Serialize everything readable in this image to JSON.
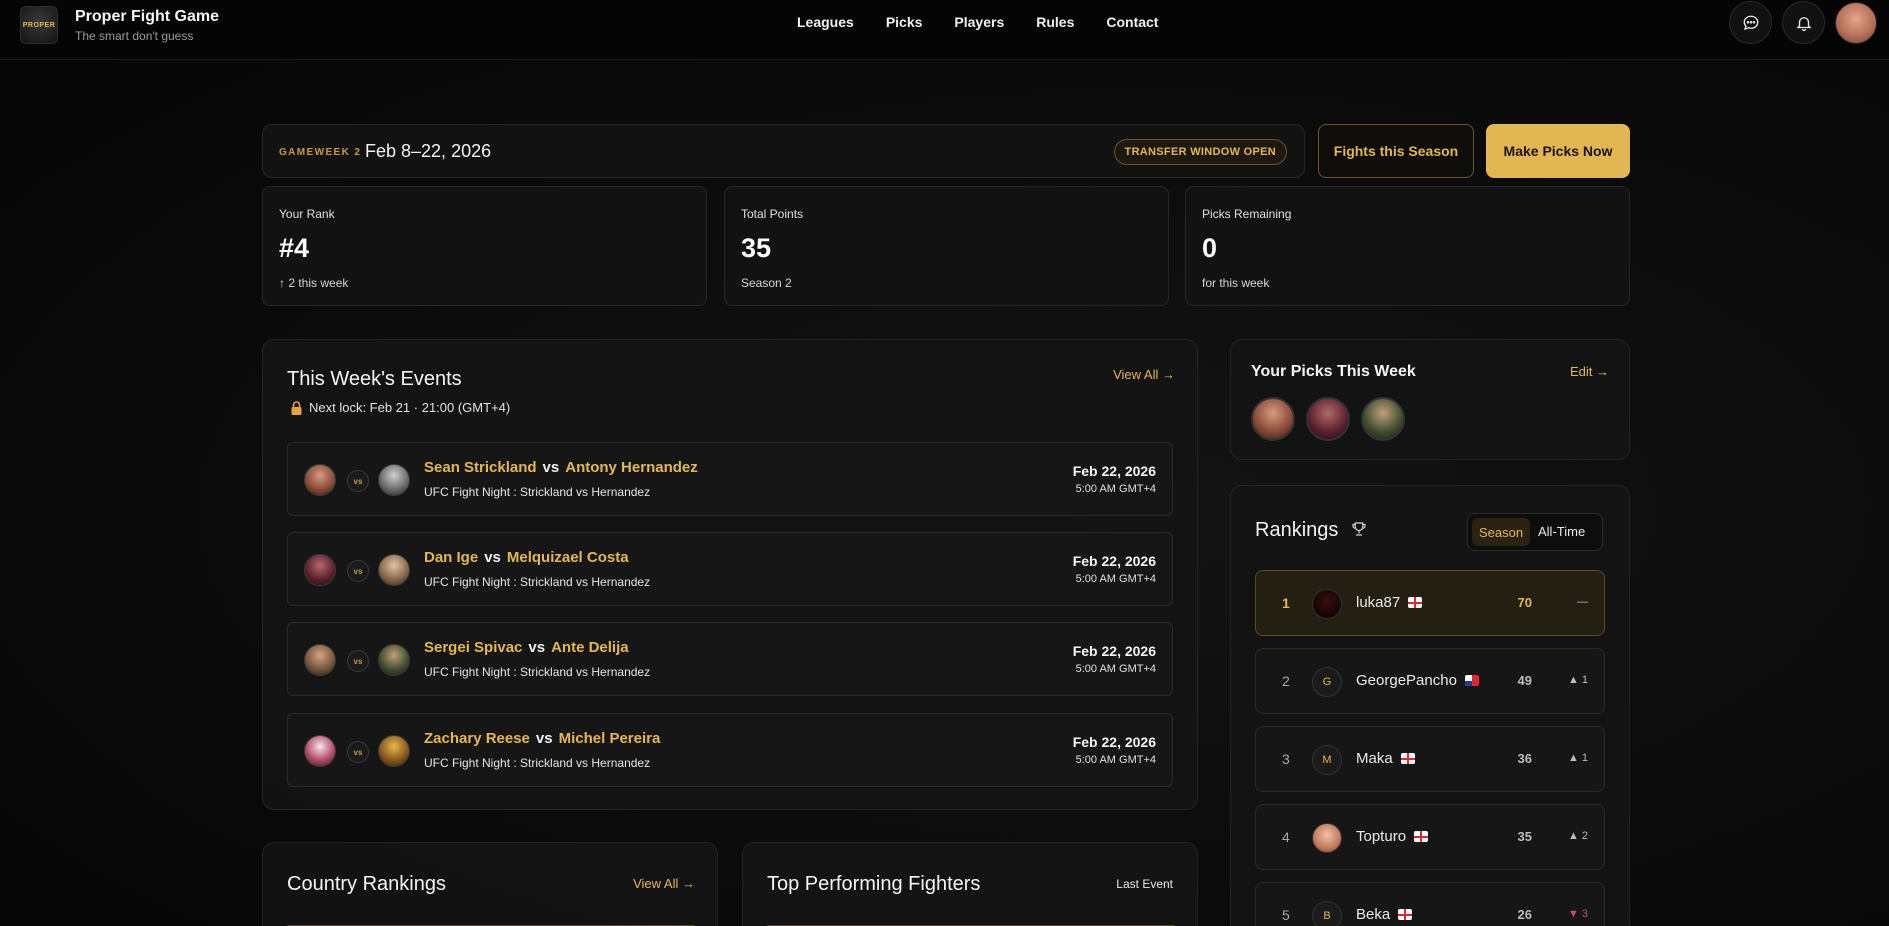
{
  "nav": {
    "logo_text": "PROPER",
    "brand_name": "Proper Fight Game",
    "brand_tagline": "The smart don't guess",
    "menu": [
      "Leagues",
      "Picks",
      "Players",
      "Rules",
      "Contact"
    ]
  },
  "gameweek": {
    "label": "GAMEWEEK 2",
    "date_range": "Feb 8–22, 2026",
    "badge": "TRANSFER WINDOW OPEN"
  },
  "buttons": {
    "fights_season": "Fights this Season",
    "make_picks": "Make Picks Now"
  },
  "stats": [
    {
      "label": "Your Rank",
      "value": "#4",
      "sub": "↑ 2 this week"
    },
    {
      "label": "Total Points",
      "value": "35",
      "sub": "Season 2"
    },
    {
      "label": "Picks Remaining",
      "value": "0",
      "sub": "for this week"
    }
  ],
  "events": {
    "title": "This Week's Events",
    "view_all": "View All →",
    "next_lock": "Next lock: Feb 21 · 21:00 (GMT+4)",
    "vs_label": "vs",
    "fights": [
      {
        "fighter_a": "Sean Strickland",
        "fighter_b": "Antony Hernandez",
        "event": "UFC Fight Night : Strickland vs Hernandez",
        "date": "Feb 22, 2026",
        "time": "5:00 AM GMT+4"
      },
      {
        "fighter_a": "Dan Ige",
        "fighter_b": "Melquizael Costa",
        "event": "UFC Fight Night : Strickland vs Hernandez",
        "date": "Feb 22, 2026",
        "time": "5:00 AM GMT+4"
      },
      {
        "fighter_a": "Sergei Spivac",
        "fighter_b": "Ante Delija",
        "event": "UFC Fight Night : Strickland vs Hernandez",
        "date": "Feb 22, 2026",
        "time": "5:00 AM GMT+4"
      },
      {
        "fighter_a": "Zachary Reese",
        "fighter_b": "Michel Pereira",
        "event": "UFC Fight Night : Strickland vs Hernandez",
        "date": "Feb 22, 2026",
        "time": "5:00 AM GMT+4"
      }
    ]
  },
  "my_picks": {
    "title": "Your Picks This Week",
    "edit": "Edit →"
  },
  "rankings": {
    "title": "Rankings",
    "toggle_season": "Season",
    "toggle_all_time": "All-Time",
    "rows": [
      {
        "rank": "1",
        "initial": "",
        "name": "luka87",
        "points": "70",
        "change": "—"
      },
      {
        "rank": "2",
        "initial": "G",
        "name": "GeorgePancho",
        "points": "49",
        "change": "▲ 1"
      },
      {
        "rank": "3",
        "initial": "M",
        "name": "Maka",
        "points": "36",
        "change": "▲ 1"
      },
      {
        "rank": "4",
        "initial": "",
        "name": "Topturo",
        "points": "35",
        "change": "▲ 2"
      },
      {
        "rank": "5",
        "initial": "B",
        "name": "Beka",
        "points": "26",
        "change": "▼ 3"
      }
    ]
  },
  "country_rankings": {
    "title": "Country Rankings",
    "view_all": "View All →"
  },
  "top_fighters": {
    "title": "Top Performing Fighters",
    "filter": "Last Event"
  },
  "colors": {
    "accent": "#e6b84c",
    "button_solid": "#e3b654",
    "background": "#0b0b0b",
    "card": "#121212",
    "down": "#c0505a"
  }
}
